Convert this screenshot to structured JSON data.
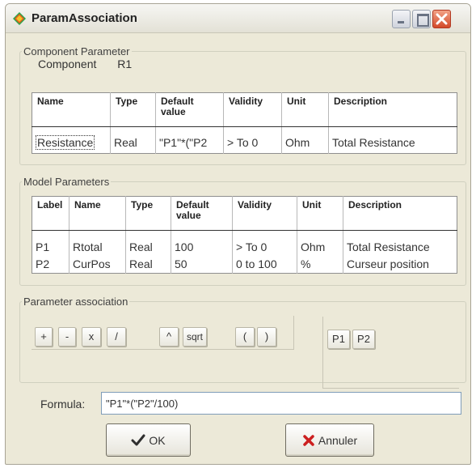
{
  "window": {
    "title": "ParamAssociation"
  },
  "component_parameter": {
    "legend": "Component Parameter",
    "component_label": "Component",
    "component_value": "R1",
    "columns": [
      "Name",
      "Type",
      "Default\nvalue",
      "Validity",
      "Unit",
      "Description"
    ],
    "rows": [
      [
        "Resistance",
        "Real",
        "\"P1\"*(\"P2",
        "> To 0",
        "Ohm",
        "Total Resistance"
      ]
    ]
  },
  "model_parameters": {
    "legend": "Model Parameters",
    "columns": [
      "Label",
      "Name",
      "Type",
      "Default\nvalue",
      "Validity",
      "Unit",
      "Description"
    ],
    "rows": [
      [
        "P1",
        "Rtotal",
        "Real",
        "100",
        "> To 0",
        "Ohm",
        "Total Resistance"
      ],
      [
        "P2",
        "CurPos",
        "Real",
        "50",
        "0 to 100",
        "%",
        "Curseur position"
      ]
    ]
  },
  "association": {
    "legend": "Parameter association",
    "operators": [
      "+",
      "-",
      "x",
      "/",
      "^",
      "sqrt",
      "(",
      ")"
    ],
    "params": [
      "P1",
      "P2"
    ]
  },
  "formula": {
    "label": "Formula:",
    "value": "\"P1\"*(\"P2\"/100)"
  },
  "buttons": {
    "ok": "OK",
    "cancel": "Annuler"
  },
  "icons": {
    "app": "diamond-app-icon",
    "ok": "checkmark-icon",
    "cancel": "red-x-icon"
  },
  "colors": {
    "window_bg": "#ece9d8",
    "close_button": "#d34a2a",
    "cancel_icon": "#cc1f1f",
    "ok_icon": "#2f2f2f"
  }
}
